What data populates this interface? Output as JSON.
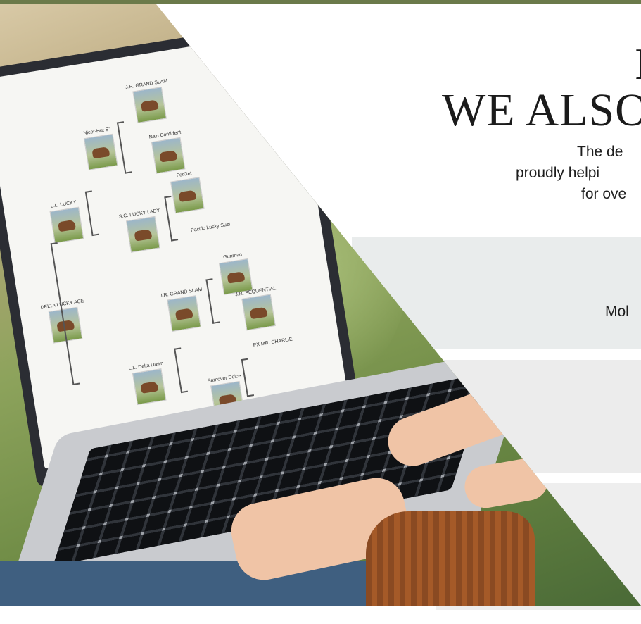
{
  "header": {
    "small_title": "I",
    "headline": "WE ALSO",
    "subtitle_lines": [
      "The de",
      "proudly helpi",
      "for ove"
    ]
  },
  "band": {
    "text": "Mol"
  },
  "pedigree": {
    "nodes": [
      {
        "label": "J.R. GRAND SLAM"
      },
      {
        "label": "Nicer-Hut ST"
      },
      {
        "label": "Nazi Confident"
      },
      {
        "label": "L.L. LUCKY"
      },
      {
        "label": "ForGet"
      },
      {
        "label": "S.C. LUCKY LADY"
      },
      {
        "label": "Pacific Lucky Suzi"
      },
      {
        "label": "DELTA LUCKY ACE"
      },
      {
        "label": "Gunman"
      },
      {
        "label": "J.R. GRAND SLAM"
      },
      {
        "label": "J.R. SEQUENTIAL"
      },
      {
        "label": "L.L. Delta Dawn"
      },
      {
        "label": "PX MR. CHARLIE"
      },
      {
        "label": "Samover Dolce"
      }
    ]
  },
  "colors": {
    "topbar": "#6b7a4a",
    "band": "#e9ecec",
    "text": "#1b1b1b"
  }
}
